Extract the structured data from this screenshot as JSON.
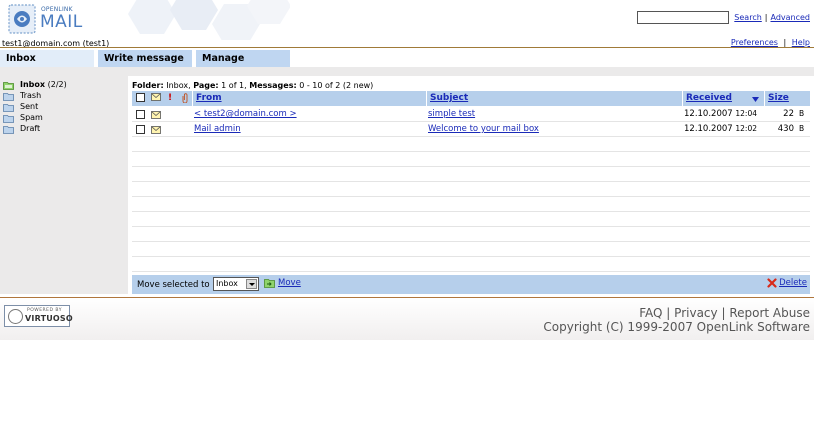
{
  "app": {
    "logo_small": "OPENLINK",
    "logo_big": "MAIL"
  },
  "search": {
    "value": "",
    "search_link": "Search",
    "advanced_link": "Advanced"
  },
  "user": {
    "label": "test1@domain.com (test1)"
  },
  "toplinks": {
    "preferences": "Preferences",
    "help": "Help"
  },
  "tabs": [
    {
      "label": "Inbox",
      "active": true
    },
    {
      "label": "Write message",
      "active": false
    },
    {
      "label": "Manage",
      "active": false
    }
  ],
  "sidebar": {
    "folders": [
      {
        "name": "Inbox",
        "count": "(2/2)",
        "active": true
      },
      {
        "name": "Trash",
        "count": "",
        "active": false
      },
      {
        "name": "Sent",
        "count": "",
        "active": false
      },
      {
        "name": "Spam",
        "count": "",
        "active": false
      },
      {
        "name": "Draft",
        "count": "",
        "active": false
      }
    ]
  },
  "folder_info": {
    "folder_label": "Folder:",
    "folder_value": "Inbox,",
    "page_label": "Page:",
    "page_value": "1 of 1,",
    "messages_label": "Messages:",
    "messages_value": "0 - 10 of 2 (2 new)"
  },
  "table": {
    "headers": {
      "from": "From",
      "subject": "Subject",
      "received": "Received",
      "size": "Size",
      "priority": "!"
    },
    "rows": [
      {
        "from": "< test2@domain.com >",
        "subject": "simple test",
        "date": "12.10.2007",
        "time": "12:04",
        "size": "22",
        "unit": "B"
      },
      {
        "from": "Mail admin",
        "subject": "Welcome to your mail box",
        "date": "12.10.2007",
        "time": "12:02",
        "size": "430",
        "unit": "B"
      }
    ]
  },
  "actions": {
    "move_selected_label": "Move selected to",
    "move_target": "Inbox",
    "move_button": "Move",
    "delete_button": "Delete"
  },
  "footer": {
    "powered_by": "POWERED BY",
    "virtuoso": "VIRTUOSO",
    "faq": "FAQ",
    "privacy": "Privacy",
    "report_abuse": "Report Abuse",
    "sep": "|",
    "copyright": "Copyright (C) 1999-2007 OpenLink Software"
  },
  "colors": {
    "link": "#1a2ab8",
    "tab_active": "#e2edf9",
    "tab_inactive": "#bfd6f1",
    "header_bar": "#b6cfeb",
    "sidebar": "#ebeaea",
    "rule": "#a07a38"
  }
}
